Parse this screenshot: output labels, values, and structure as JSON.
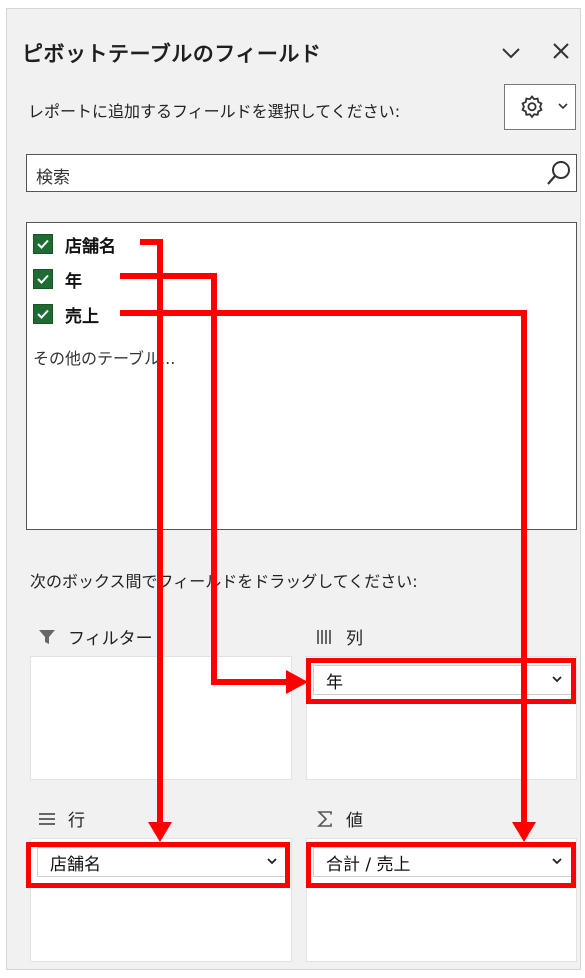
{
  "panel": {
    "title": "ピボットテーブルのフィールド",
    "instruction": "レポートに追加するフィールドを選択してください:",
    "settings_caret": "⌄"
  },
  "search": {
    "placeholder": "検索"
  },
  "fields": [
    {
      "label": "店舗名",
      "checked": true
    },
    {
      "label": "年",
      "checked": true
    },
    {
      "label": "売上",
      "checked": true
    }
  ],
  "more_tables": "その他のテーブル...",
  "drag_instruction": "次のボックス間でフィールドをドラッグしてください:",
  "areas": {
    "filters": {
      "label": "フィルター",
      "items": []
    },
    "columns": {
      "label": "列",
      "items": [
        "年"
      ]
    },
    "rows": {
      "label": "行",
      "items": [
        "店舗名"
      ]
    },
    "values": {
      "label": "値",
      "items": [
        "合計 / 売上"
      ]
    }
  },
  "colors": {
    "arrow": "#ff0000",
    "checkbox": "#1e6b33"
  }
}
